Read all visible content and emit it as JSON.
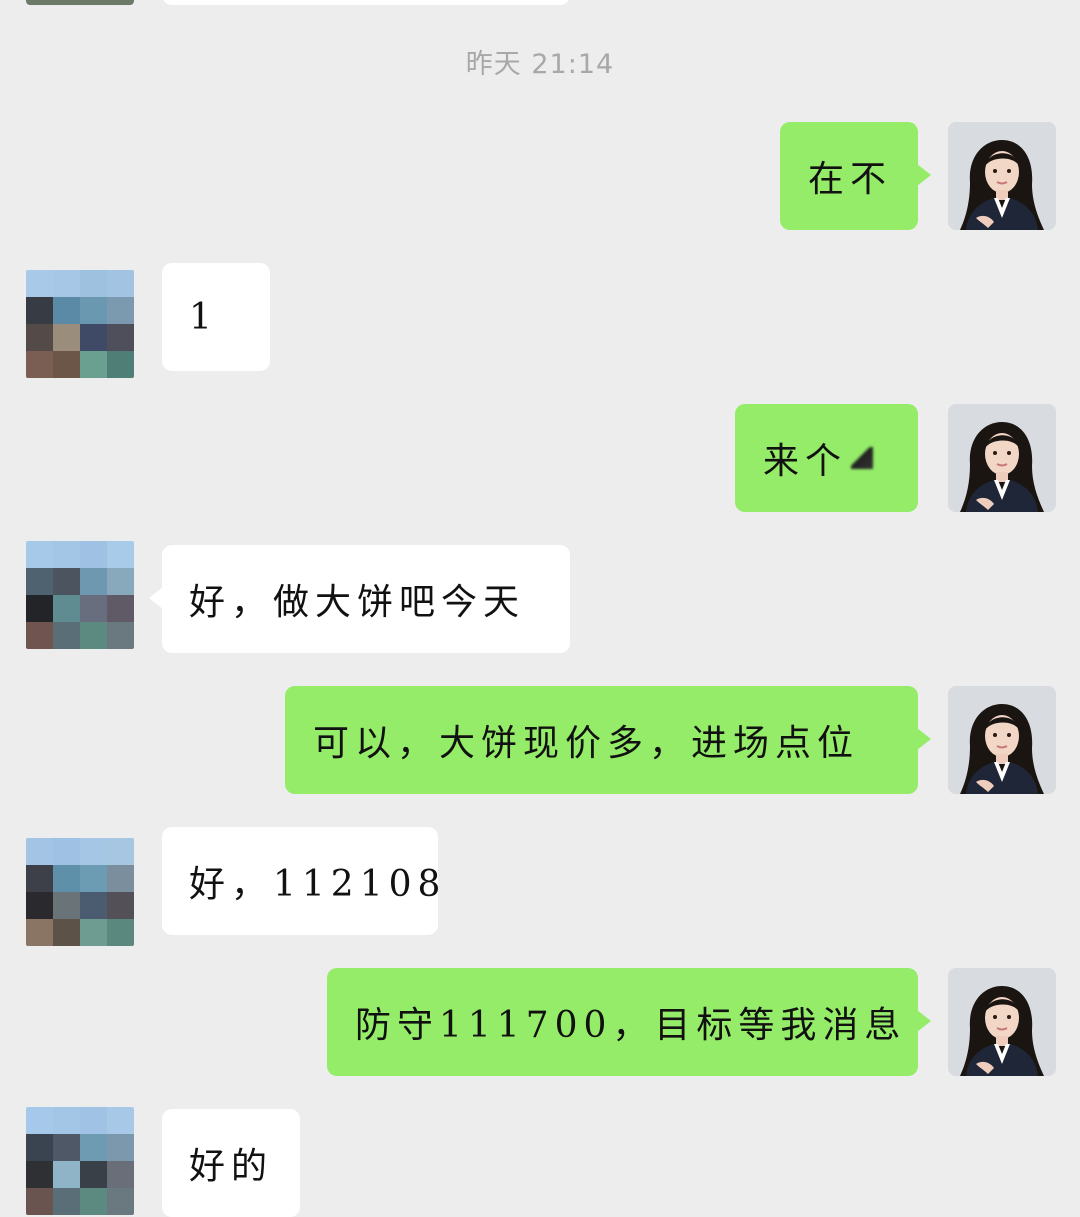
{
  "timestamp": "昨天 21:14",
  "colors": {
    "background": "#ededed",
    "my_bubble": "#95ec69",
    "their_bubble": "#ffffff"
  },
  "my_avatar_icon": "woman-in-suit-avatar",
  "their_avatar_icon": "pixelated-avatar",
  "messages": [
    {
      "sender": "me",
      "text": "在不"
    },
    {
      "sender": "them",
      "text": "1"
    },
    {
      "sender": "me",
      "text": "来个"
    },
    {
      "sender": "them",
      "text": "好，做大饼吧今天"
    },
    {
      "sender": "me",
      "text": "可以，大饼现价多，进场点位"
    },
    {
      "sender": "them",
      "text": "好，112108"
    },
    {
      "sender": "me",
      "text": "防守111700，目标等我消息"
    },
    {
      "sender": "them",
      "text": "好的"
    }
  ]
}
